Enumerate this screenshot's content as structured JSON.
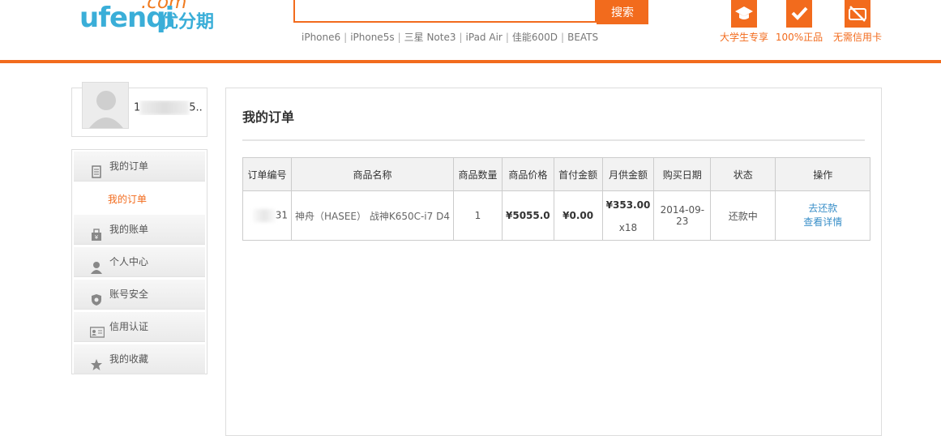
{
  "header": {
    "logo": {
      "brand": "ufenqi",
      "dotcom": ".com",
      "cn": "优分期"
    },
    "search": {
      "button_label": "搜索",
      "value": ""
    },
    "hot_words": [
      "iPhone6",
      "iPhone5s",
      "三星 Note3",
      "iPad Air",
      "佳能600D",
      "BEATS"
    ],
    "badges": [
      {
        "icon": "graduation-cap-icon",
        "label": "大学生专享"
      },
      {
        "icon": "checkmark-shield-icon",
        "label": "100%正品"
      },
      {
        "icon": "no-credit-card-icon",
        "label": "无需信用卡"
      }
    ],
    "accent_color": "#f26b1d"
  },
  "user": {
    "name_visible": "1",
    "name_suffix": "5..."
  },
  "sidebar": {
    "items": [
      {
        "icon": "document-icon",
        "label": "我的订单"
      },
      {
        "icon": "bill-icon",
        "label": "我的账单"
      },
      {
        "icon": "person-icon",
        "label": "个人中心"
      },
      {
        "icon": "shield-icon",
        "label": "账号安全"
      },
      {
        "icon": "id-card-icon",
        "label": "信用认证"
      },
      {
        "icon": "star-icon",
        "label": "我的收藏"
      }
    ],
    "active_sub": "我的订单"
  },
  "main": {
    "title": "我的订单",
    "table": {
      "headers": [
        "订单编号",
        "商品名称",
        "商品数量",
        "商品价格",
        "首付金额",
        "月供金额",
        "购买日期",
        "状态",
        "操作"
      ],
      "rows": [
        {
          "order_id_suffix": "31",
          "product": "神舟（HASEE） 战神K650C-i7 D4",
          "quantity": "1",
          "price": "¥5055.0",
          "down_payment": "¥0.00",
          "monthly": "¥353.00",
          "months": "x18",
          "date": "2014-09-23",
          "status": "还款中",
          "actions": [
            "去还款",
            "查看详情"
          ]
        }
      ]
    }
  }
}
